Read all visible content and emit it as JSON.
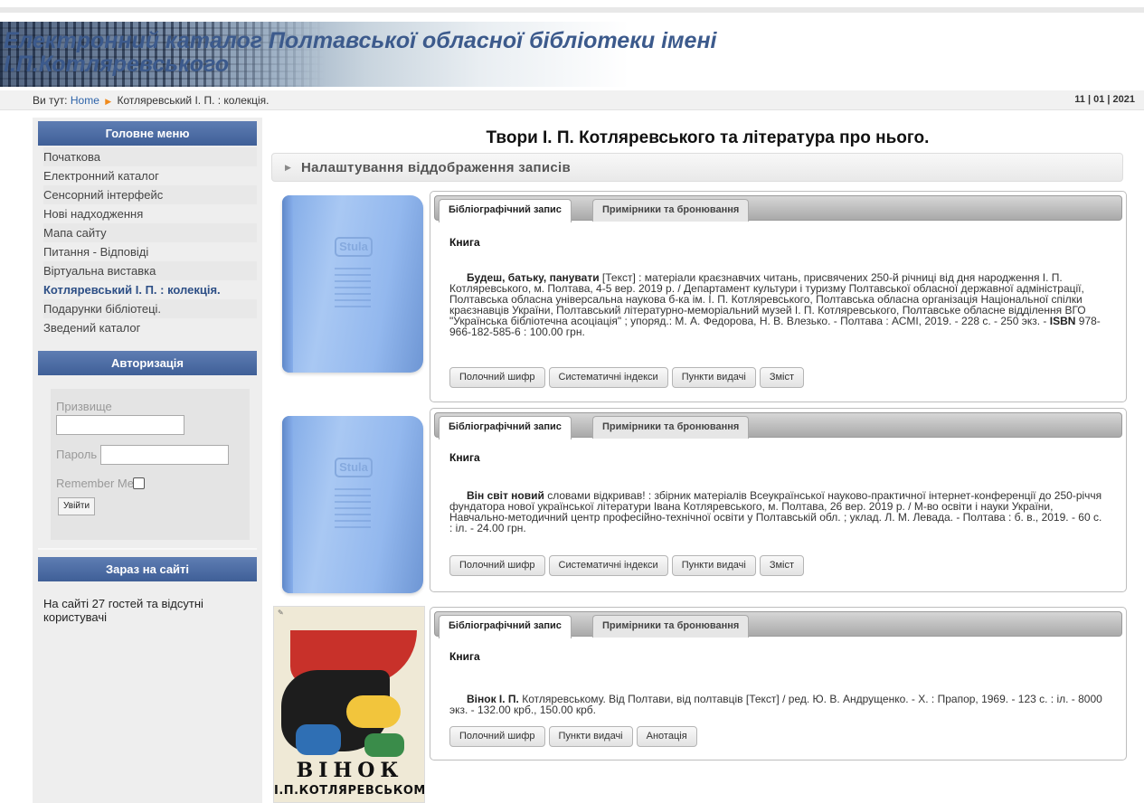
{
  "header": {
    "title": "Електронний каталог Полтавської обласної бібліотеки імені І.П.Котляревського"
  },
  "breadcrumb": {
    "prefix": "Ви тут:",
    "home": "Home",
    "current": "Котляревський І. П. : колекція.",
    "date": "11 | 01 | 2021"
  },
  "sidebar": {
    "main_menu_title": "Головне меню",
    "items": [
      {
        "label": "Початкова"
      },
      {
        "label": "Електронний каталог"
      },
      {
        "label": "Сенсорний інтерфейс"
      },
      {
        "label": "Нові надходження"
      },
      {
        "label": "Мапа сайту"
      },
      {
        "label": "Питання - Відповіді"
      },
      {
        "label": "Віртуальна виставка"
      },
      {
        "label": "Котляревський І. П. : колекція.",
        "active": true
      },
      {
        "label": "Подарунки бібліотеці."
      },
      {
        "label": "Зведений каталог"
      }
    ],
    "auth": {
      "title": "Авторизація",
      "surname_label": "Призвище",
      "password_label": "Пароль",
      "remember_label": "Remember Me",
      "login_button": "Увійти"
    },
    "online": {
      "title": "Зараз на сайті",
      "text": "На сайті 27 гостей та відсутні користувачі"
    }
  },
  "main": {
    "page_title": "Твори І. П. Котляревського та література про нього.",
    "settings_label": "Налаштування віддображення записів",
    "tabs": {
      "biblio": "Бібліографічний запис",
      "copies": "Примірники та бронювання"
    },
    "records": [
      {
        "kind": "Книга",
        "title": "Будеш, батьку, панувати",
        "text": "[Текст] : матеріали краєзнавчих читань, присвячених 250-й річниці від дня народження І. П. Котляревського, м. Полтава, 4-5 вер. 2019 р. / Департамент культури і туризму Полтавської обласної державної адміністрації, Полтавська обласна універсальна наукова б-ка ім. І. П. Котляревського, Полтавська обласна організація Національної спілки краєзнавців України, Полтавський літературно-меморіальний музей І. П. Котляревського, Полтавське обласне відділення ВГО \"Українська бібліотечна асоціація\" ; упоряд.: М. А. Федорова, Н. В. Влезько. - Полтава : АСМІ, 2019. - 228 с. - 250 экз. -",
        "isbn_label": "ISBN",
        "isbn_tail": "978-966-182-585-6 : 100.00 грн.",
        "buttons": [
          "Полочний шифр",
          "Систематичні індекси",
          "Пункти видачі",
          "Зміст"
        ]
      },
      {
        "kind": "Книга",
        "title": "Він світ новий",
        "text": "словами відкривав! : збірник матеріалів Всеукраїнської науково-практичної інтернет-конференції до 250-річчя фундатора нової української літератури Івана Котляревського, м. Полтава, 26 вер. 2019 р. / М-во освіти і науки України, Навчально-методичний центр професійно-технічної освіти у Полтавській обл. ; уклад. Л. М. Левада. - Полтава : б. в., 2019. - 60 с. : іл. - 24.00 грн.",
        "buttons": [
          "Полочний шифр",
          "Систематичні індекси",
          "Пункти видачі",
          "Зміст"
        ]
      },
      {
        "kind": "Книга",
        "title": "Вінок І. П.",
        "text": "Котляревському. Від Полтави, від полтавців [Текст] / ред. Ю. В. Андрущенко. - Х. : Прапор, 1969. - 123 с. : іл. - 8000 экз. - 132.00 крб., 150.00 крб.",
        "buttons": [
          "Полочний шифр",
          "Пункти видачі",
          "Анотація"
        ]
      }
    ],
    "covers": {
      "stub_emblem": "Stula",
      "art_word": "ВІНОК",
      "art_name": "І.П.КОТЛЯРЕВСЬКОМУ"
    }
  },
  "colors": {
    "menu_header": "#4a6aa3",
    "link": "#2d63a9",
    "breadcrumb_arrow": "#f08a1c",
    "title_text": "#3c5a8c"
  }
}
